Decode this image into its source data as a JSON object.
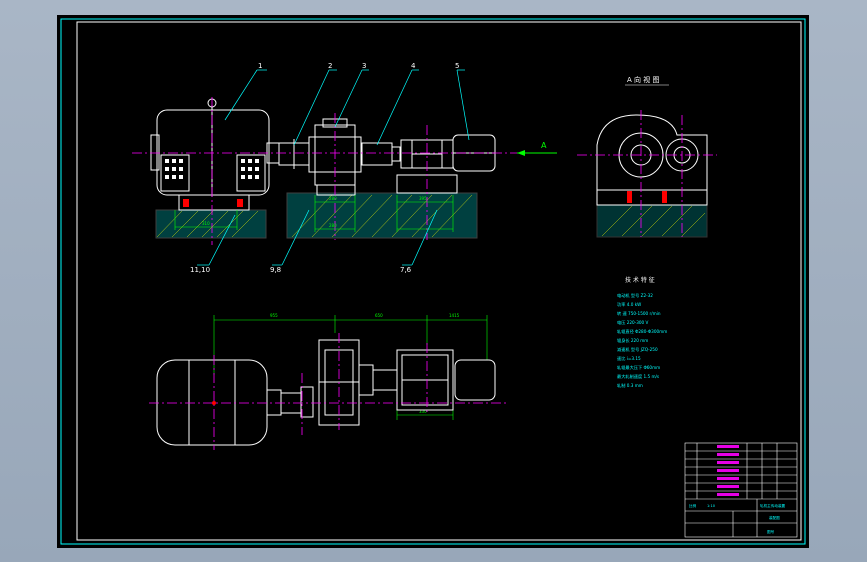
{
  "drawing": {
    "view_title": "A 向 视 图",
    "view_arrow_label": "A",
    "part_balloons": [
      "1",
      "2",
      "3",
      "4",
      "5"
    ],
    "lower_balloons": [
      "11,10",
      "9,8",
      "7,6"
    ],
    "spec_title": "技 术 特 征",
    "spec_lines": [
      "电动机 型号 Z2-32",
      "功率 4.0 kW",
      "转 速 750-1500 r/min",
      "电压 220-300 V",
      "轧辊直径 Φ280-Φ300mm",
      "辊身长 220 mm",
      "减速机 型号 JZQ-250",
      "速比 i=3.15",
      "轧辊最大压下 Φ60mm",
      "最大轧制速度 1.5 m/s",
      "轧制 0.3 mm"
    ],
    "dims_top": [
      "955",
      "650",
      "1415"
    ],
    "dims_small": [
      "310",
      "280",
      "280",
      "395"
    ],
    "dims_plan": [
      "330"
    ],
    "title_block_labels": [
      "轧机主传动装置",
      "装配图",
      "比例",
      "1:10",
      "图号"
    ]
  },
  "colors": {
    "background": "#000000",
    "outline": "#ffffff",
    "dimension": "#00ff00",
    "leader": "#00ffff",
    "centerline": "#ff00ff",
    "hatch": "#ffff00",
    "frame": "#00ffff"
  }
}
